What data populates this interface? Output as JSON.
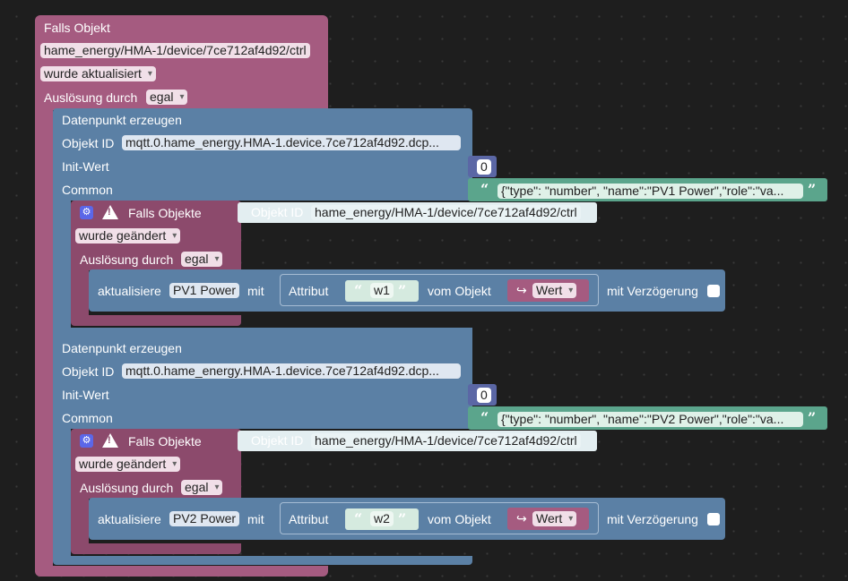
{
  "falls_objekt": {
    "title": "Falls Objekt",
    "object_id": "hame_energy/HMA-1/device/7ce712af4d92/ctrl",
    "trigger": "wurde aktualisiert",
    "ausloesung_label": "Auslösung durch",
    "ausloesung_value": "egal"
  },
  "datenpunkte": [
    {
      "title": "Datenpunkt erzeugen",
      "object_id_label": "Objekt ID",
      "object_id": "mqtt.0.hame_energy.HMA-1.device.7ce712af4d92.dcp...",
      "init_label": "Init-Wert",
      "init_value": "0",
      "common_label": "Common",
      "common_value": "{\"type\": \"number\", \"name\":\"PV1 Power\",\"role\":\"va...",
      "falls_objekte": {
        "title": "Falls Objekte",
        "object_id_label": "Objekt ID",
        "object_id": "hame_energy/HMA-1/device/7ce712af4d92/ctrl",
        "trigger": "wurde geändert",
        "ausloesung_label": "Auslösung durch",
        "ausloesung_value": "egal"
      },
      "aktualisiere": {
        "label": "aktualisiere",
        "target": "PV1 Power",
        "mit": "mit",
        "attribut_label": "Attribut",
        "attribut_value": "w1",
        "vom_objekt": "vom Objekt",
        "wert": "Wert",
        "verzoegerung": "mit Verzögerung"
      }
    },
    {
      "title": "Datenpunkt erzeugen",
      "object_id_label": "Objekt ID",
      "object_id": "mqtt.0.hame_energy.HMA-1.device.7ce712af4d92.dcp...",
      "init_label": "Init-Wert",
      "init_value": "0",
      "common_label": "Common",
      "common_value": "{\"type\": \"number\", \"name\":\"PV2 Power\",\"role\":\"va...",
      "falls_objekte": {
        "title": "Falls Objekte",
        "object_id_label": "Objekt ID",
        "object_id": "hame_energy/HMA-1/device/7ce712af4d92/ctrl",
        "trigger": "wurde geändert",
        "ausloesung_label": "Auslösung durch",
        "ausloesung_value": "egal"
      },
      "aktualisiere": {
        "label": "aktualisiere",
        "target": "PV2 Power",
        "mit": "mit",
        "attribut_label": "Attribut",
        "attribut_value": "w2",
        "vom_objekt": "vom Objekt",
        "wert": "Wert",
        "verzoegerung": "mit Verzögerung"
      }
    }
  ],
  "colors": {
    "trigger_block": "#a55b80",
    "datapoint_block": "#5b80a5",
    "text_block": "#5ba58c",
    "number_block": "#5b67a5"
  },
  "icons": [
    "gear-icon",
    "warning-icon",
    "quote-open-icon",
    "quote-close-icon",
    "arrow-icon"
  ]
}
